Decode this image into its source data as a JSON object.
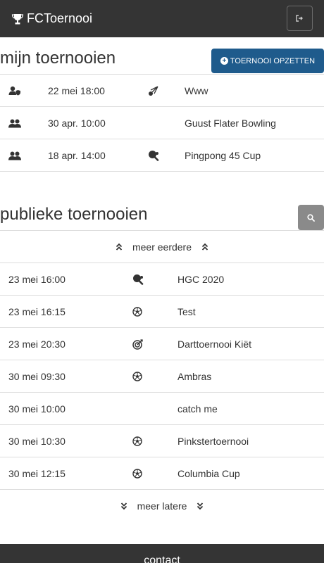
{
  "navbar": {
    "brand": "FCToernooi",
    "icons": {
      "brand": "trophy-icon",
      "logout": "sign-out-icon"
    }
  },
  "mine": {
    "title": "mijn toernooien",
    "create_label": "TOERNOOI OPZETTEN",
    "rows": [
      {
        "role_icon": "user-shield-icon",
        "date": "22 mei 18:00",
        "sport_icon": "badminton-shuttle-icon",
        "name": "Www"
      },
      {
        "role_icon": "users-icon",
        "date": "30 apr. 10:00",
        "sport_icon": "",
        "name": "Guust Flater Bowling"
      },
      {
        "role_icon": "users-icon",
        "date": "18 apr. 14:00",
        "sport_icon": "table-tennis-icon",
        "name": "Pingpong 45 Cup"
      }
    ]
  },
  "public": {
    "title": "publieke toernooien",
    "more_before": "meer eerdere",
    "more_after": "meer latere",
    "rows": [
      {
        "date": "23 mei 16:00",
        "sport_icon": "table-tennis-icon",
        "name": "HGC 2020"
      },
      {
        "date": "23 mei 16:15",
        "sport_icon": "football-icon",
        "name": "Test"
      },
      {
        "date": "23 mei 20:30",
        "sport_icon": "dart-target-icon",
        "name": "Darttoernooi Kiët"
      },
      {
        "date": "30 mei 09:30",
        "sport_icon": "football-icon",
        "name": "Ambras"
      },
      {
        "date": "30 mei 10:00",
        "sport_icon": "",
        "name": "catch me"
      },
      {
        "date": "30 mei 10:30",
        "sport_icon": "football-icon",
        "name": "Pinkstertoernooi"
      },
      {
        "date": "30 mei 12:15",
        "sport_icon": "football-icon",
        "name": "Columbia Cup"
      }
    ]
  },
  "footer": {
    "title": "contact"
  },
  "colors": {
    "navbar": "#343434",
    "primary": "#1f5b8c",
    "search": "#8a8a8a",
    "divider": "#dddddd"
  }
}
